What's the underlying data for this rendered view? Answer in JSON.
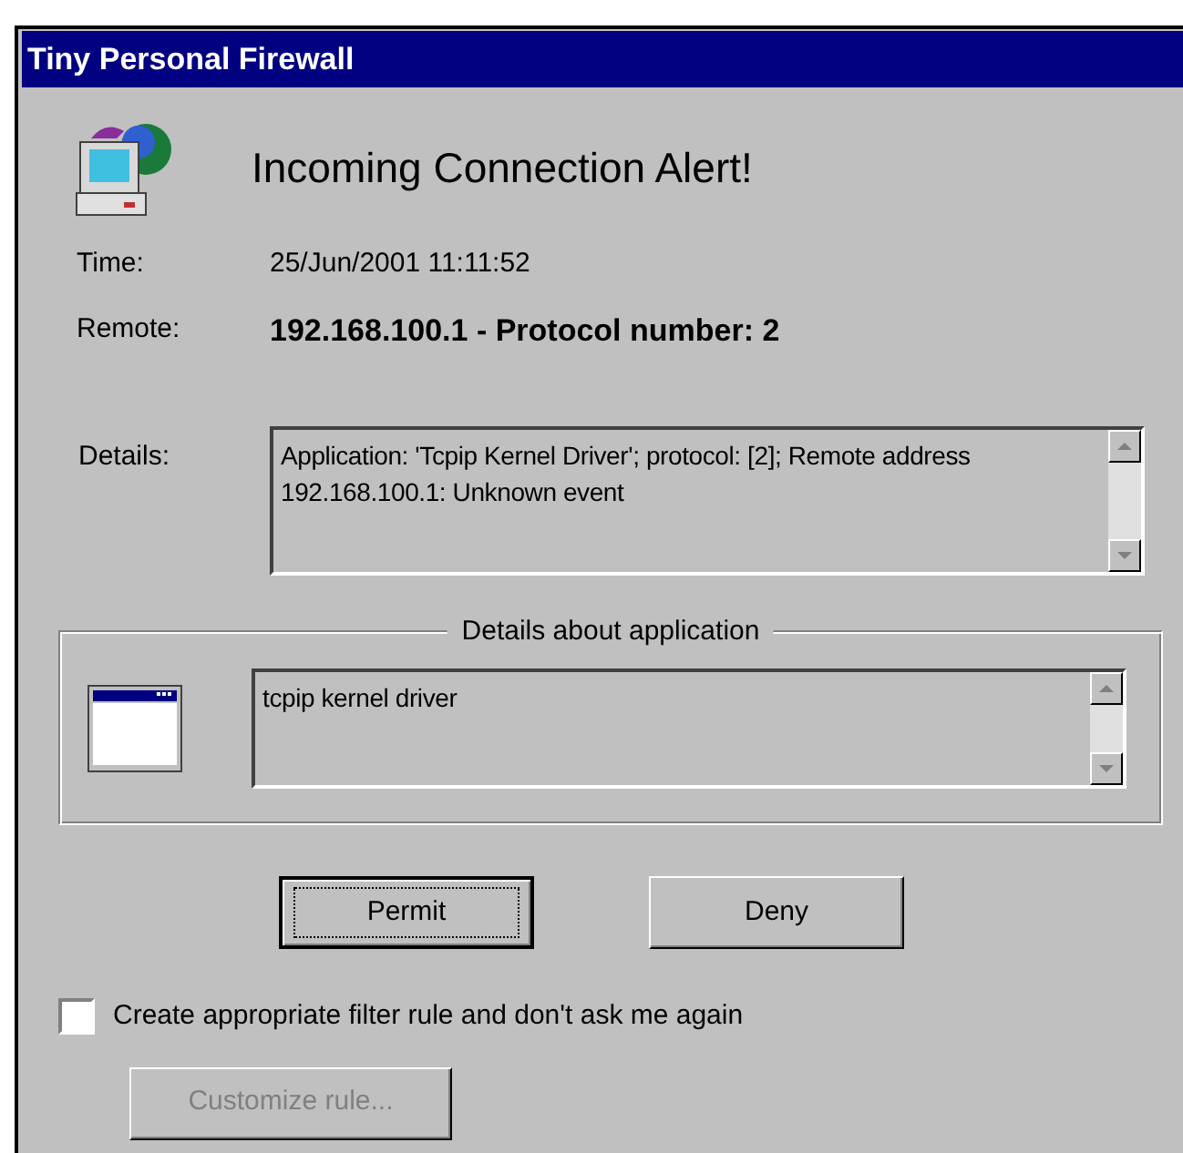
{
  "window": {
    "title": "Tiny Personal Firewall"
  },
  "heading": "Incoming Connection Alert!",
  "info": [
    {
      "label": "Time:",
      "value": "25/Jun/2001 11:11:52",
      "bold": false
    },
    {
      "label": "Remote:",
      "value": "192.168.100.1 - Protocol number: 2",
      "bold": true
    }
  ],
  "details": {
    "label": "Details:",
    "value": "Application: 'Tcpip Kernel Driver'; protocol: [2]; Remote address 192.168.100.1: Unknown event"
  },
  "application_group": {
    "title": "Details about application",
    "value": "tcpip kernel driver"
  },
  "buttons": [
    {
      "label": "Permit",
      "focused": true
    },
    {
      "label": "Deny",
      "focused": false
    }
  ],
  "remember": {
    "label": "Create appropriate filter rule and don't ask me again",
    "checked": false
  },
  "customize_button": {
    "label": "Customize rule...",
    "disabled": true
  }
}
